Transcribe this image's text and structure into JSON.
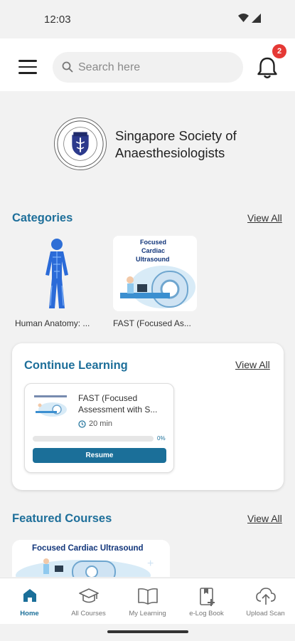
{
  "status_bar": {
    "time": "12:03"
  },
  "header": {
    "search": {
      "placeholder": "Search here"
    },
    "notifications": {
      "count": "2"
    }
  },
  "organization": {
    "name": "Singapore Society of Anaesthesiologists"
  },
  "categories": {
    "title": "Categories",
    "view_all": "View All",
    "items": [
      {
        "label": "Human Anatomy: ..."
      },
      {
        "label": "FAST (Focused As...",
        "image_text": [
          "Focused",
          "Cardiac",
          "Ultrasound"
        ]
      }
    ]
  },
  "continue_learning": {
    "title": "Continue Learning",
    "view_all": "View All",
    "course": {
      "title": "FAST (Focused Assessment with S...",
      "duration": "20 min",
      "progress_percent": 0,
      "progress_label": "0%",
      "resume_label": "Resume"
    }
  },
  "featured_courses": {
    "title": "Featured Courses",
    "view_all": "View All",
    "items": [
      {
        "image_text": "Focused Cardiac Ultrasound"
      }
    ]
  },
  "bottom_nav": {
    "items": [
      {
        "label": "Home",
        "icon": "home-icon",
        "active": true
      },
      {
        "label": "All Courses",
        "icon": "graduation-cap-icon",
        "active": false
      },
      {
        "label": "My Learning",
        "icon": "book-open-icon",
        "active": false
      },
      {
        "label": "e-Log Book",
        "icon": "logbook-add-icon",
        "active": false
      },
      {
        "label": "Upload Scan",
        "icon": "cloud-upload-icon",
        "active": false
      }
    ]
  },
  "colors": {
    "accent": "#1b6f99",
    "badge": "#e53935",
    "background": "#f2f2f2"
  }
}
